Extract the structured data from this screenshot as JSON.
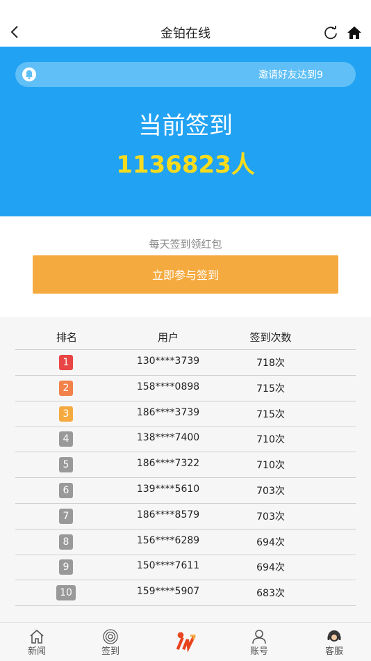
{
  "header": {
    "title": "金铂在线"
  },
  "hero": {
    "marquee": "邀请好友达到9",
    "title": "当前签到",
    "count": "1136823人"
  },
  "checkin": {
    "subtitle": "每天签到领红包",
    "button": "立即参与签到"
  },
  "ranking": {
    "columns": [
      "排名",
      "用户",
      "签到次数"
    ],
    "rows": [
      {
        "rank": "1",
        "user": "130****3739",
        "count": "718次",
        "color": "#e94545"
      },
      {
        "rank": "2",
        "user": "158****0898",
        "count": "715次",
        "color": "#f2814a"
      },
      {
        "rank": "3",
        "user": "186****3739",
        "count": "715次",
        "color": "#f5aa3f"
      },
      {
        "rank": "4",
        "user": "138****7400",
        "count": "710次",
        "color": "#999999"
      },
      {
        "rank": "5",
        "user": "186****7322",
        "count": "710次",
        "color": "#999999"
      },
      {
        "rank": "6",
        "user": "139****5610",
        "count": "703次",
        "color": "#999999"
      },
      {
        "rank": "7",
        "user": "186****8579",
        "count": "703次",
        "color": "#999999"
      },
      {
        "rank": "8",
        "user": "156****6289",
        "count": "694次",
        "color": "#999999"
      },
      {
        "rank": "9",
        "user": "150****7611",
        "count": "694次",
        "color": "#999999"
      },
      {
        "rank": "10",
        "user": "159****5907",
        "count": "683次",
        "color": "#999999"
      }
    ]
  },
  "tabs": [
    {
      "label": "新闻",
      "icon": "home-icon"
    },
    {
      "label": "签到",
      "icon": "target-icon"
    },
    {
      "label": "",
      "icon": "brand-logo-icon"
    },
    {
      "label": "账号",
      "icon": "user-icon"
    },
    {
      "label": "客服",
      "icon": "headset-icon"
    }
  ],
  "colors": {
    "hero_bg": "#22a2f3",
    "button": "#f5aa3f",
    "count": "#f7dc1e"
  }
}
